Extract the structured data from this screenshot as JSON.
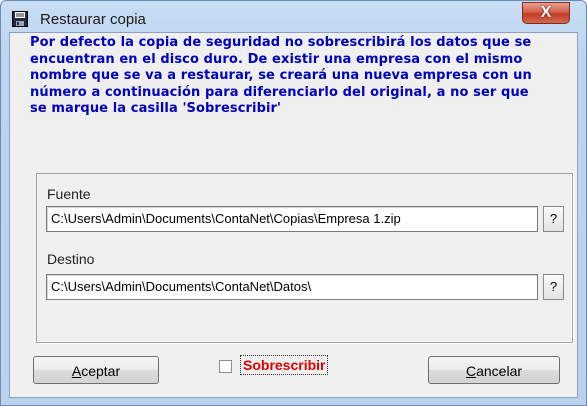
{
  "window": {
    "title": "Restaurar copia",
    "close_glyph": "X",
    "icon": "floppy-disk-icon"
  },
  "message": "Por defecto la copia de seguridad no sobrescribirá los datos que se encuentran en el disco duro. De existir una empresa con el mismo nombre que se va a restaurar, se creará una nueva empresa con un número a continuación para diferenciarlo del original, a no ser que se marque la casilla 'Sobrescribir'",
  "source": {
    "label": "Fuente",
    "path": "C:\\Users\\Admin\\Documents\\ContaNet\\Copias\\Empresa 1.zip",
    "browse_label": "?"
  },
  "destination": {
    "label": "Destino",
    "path": "C:\\Users\\Admin\\Documents\\ContaNet\\Datos\\",
    "browse_label": "?"
  },
  "buttons": {
    "accept_mnemonic": "A",
    "accept_rest": "ceptar",
    "cancel_mnemonic": "C",
    "cancel_rest": "ancelar"
  },
  "overwrite": {
    "label": "Sobrescribir",
    "checked": false
  },
  "colors": {
    "message_text": "#0000c0",
    "overwrite_text": "#e00000",
    "close_button": "#c43b24"
  }
}
